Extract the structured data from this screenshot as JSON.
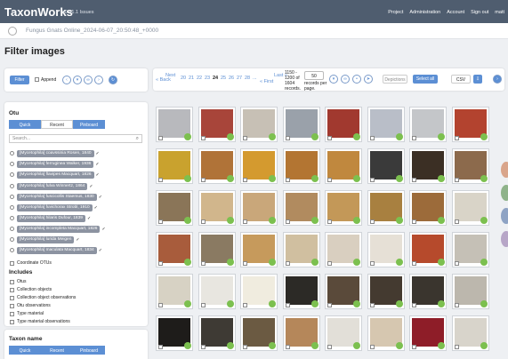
{
  "app": {
    "brand": "TaxonWorks",
    "version": "v0.41.1 Issues",
    "nav": [
      "Project",
      "Administration",
      "Account",
      "Sign out",
      "matt"
    ]
  },
  "project": {
    "name": "Fungus Gnats Online_2024-06-07_20:50:48_+0000"
  },
  "page": {
    "title": "Filter images"
  },
  "filter_bar": {
    "filter_label": "Filter",
    "append_label": "Append"
  },
  "otu": {
    "title": "Otu",
    "tabs": [
      "Quick",
      "Recent",
      "Pinboard"
    ],
    "search_placeholder": "Search...",
    "items": [
      "[Mycetophila] coavssinia Rosen, 1840",
      "[Mycetophila] ferruginea Walker, 1936",
      "[Mycetophila] flavipes Macquart, 1826",
      "[Mycetophila] fulva Winnertz, 1864",
      "[Mycetophila] fuscicollis Staemus, 1830",
      "[Mycetophila] fuvichorax Strobl, 1910",
      "[Mycetophila] hilaris Dufour, 1839",
      "[Mycetophila] incompleta Macquart, 1826",
      "[Mycetophila] lurida Meigen",
      "[Mycetophila] maculata Macquart, 1834"
    ],
    "coordinate_label": "Coordinate OTUs"
  },
  "includes": {
    "title": "Includes",
    "items": [
      "Otus",
      "Collection objects",
      "Collection object observations",
      "Otu observations",
      "Type material",
      "Type material observations"
    ]
  },
  "taxon": {
    "title": "Taxon name",
    "tabs": [
      "Quick",
      "Recent",
      "Pinboard"
    ]
  },
  "pagination": {
    "back": "« Back",
    "next": "Next",
    "pages": [
      "20",
      "21",
      "22",
      "23",
      "24",
      "25",
      "26",
      "27",
      "28",
      "..."
    ],
    "current": "24",
    "first": "« First",
    "last": "Last »",
    "records_info": "1150 - 1200 of 1604 records.",
    "per_page": "50",
    "per_page_label": "records per page.",
    "depictions_label": "Depictions",
    "select_all_label": "Select all",
    "format_value": "CSV"
  },
  "thumbnails": {
    "colors": [
      "#b8b9bd",
      "#a8453a",
      "#c7c0b5",
      "#9aa1aa",
      "#a1392f",
      "#b9bec8",
      "#c4c6c9",
      "#b3432f",
      "#c9a22e",
      "#b07338",
      "#d49a2f",
      "#b37532",
      "#c0883e",
      "#3a3a3a",
      "#3b2f24",
      "#8c6a4c",
      "#8a7558",
      "#d1b68c",
      "#c9a77a",
      "#b18b5f",
      "#c39858",
      "#a88040",
      "#9c6b3a",
      "#d9d4c8",
      "#a85c3c",
      "#8a7a62",
      "#c69a5c",
      "#d0bfa0",
      "#d9cfc0",
      "#e6e0d6",
      "#b64a2c",
      "#c5c0b6",
      "#d7d2c4",
      "#e8e6e0",
      "#f0ecdf",
      "#2c2a26",
      "#5a4a3a",
      "#443a30",
      "#3a352e",
      "#bcb7ad",
      "#1e1c1a",
      "#3e3a34",
      "#6b5a42",
      "#b5875a",
      "#e2dfd8",
      "#d6c7b0",
      "#8e1d28",
      "#d8d4cb"
    ]
  },
  "side_tabs": {
    "colors": [
      "#d9a58b",
      "#8fb38a",
      "#8ea3c4",
      "#b7a6c7"
    ]
  }
}
